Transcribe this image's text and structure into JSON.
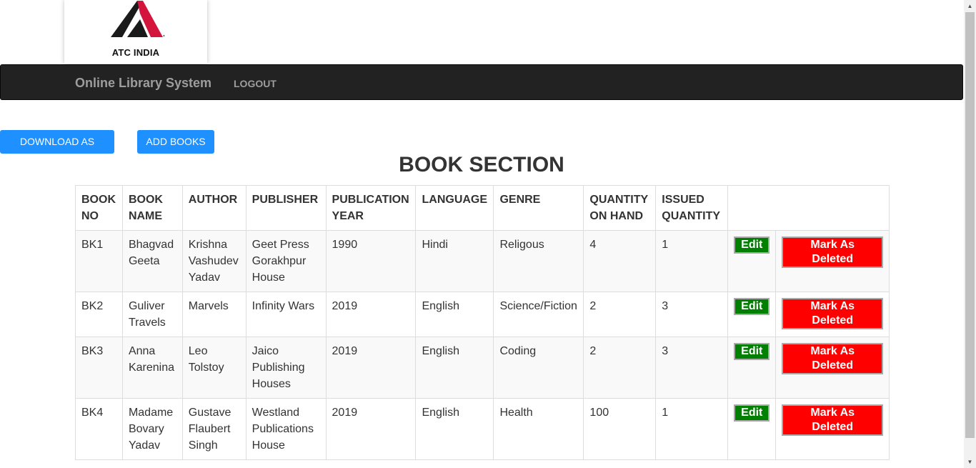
{
  "logo": {
    "text": "ATC INDIA",
    "colors": {
      "dark": "#1a1a1a",
      "red": "#d3143c"
    }
  },
  "navbar": {
    "brand": "Online Library System",
    "logout": "LOGOUT"
  },
  "actions": {
    "download_csv": "DOWNLOAD AS CSV",
    "add_books": "ADD BOOKS"
  },
  "page_title": "BOOK SECTION",
  "table": {
    "headers": {
      "book_no": "BOOK NO",
      "book_name": "BOOK NAME",
      "author": "AUTHOR",
      "publisher": "PUBLISHER",
      "publication_year": "PUBLICATION YEAR",
      "language": "LANGUAGE",
      "genre": "GENRE",
      "quantity_on_hand": "QUANTITY ON HAND",
      "issued_quantity": "ISSUED QUANTITY"
    },
    "edit_label": "Edit",
    "delete_label": "Mark As Deleted",
    "rows": [
      {
        "book_no": "BK1",
        "book_name": "Bhagvad Geeta",
        "author": "Krishna Vashudev Yadav",
        "publisher": "Geet Press Gorakhpur House",
        "year": "1990",
        "language": "Hindi",
        "genre": "Religous",
        "quantity_on_hand": "4",
        "issued": "1"
      },
      {
        "book_no": "BK2",
        "book_name": "Guliver Travels",
        "author": "Marvels",
        "publisher": "Infinity Wars",
        "year": "2019",
        "language": "English",
        "genre": "Science/Fiction",
        "quantity_on_hand": "2",
        "issued": "3"
      },
      {
        "book_no": "BK3",
        "book_name": "Anna Karenina",
        "author": "Leo Tolstoy",
        "publisher": "Jaico Publishing Houses",
        "year": "2019",
        "language": "English",
        "genre": "Coding",
        "quantity_on_hand": "2",
        "issued": "3"
      },
      {
        "book_no": "BK4",
        "book_name": "Madame Bovary Yadav",
        "author": "Gustave Flaubert Singh",
        "publisher": "Westland Publications House",
        "year": "2019",
        "language": "English",
        "genre": "Health",
        "quantity_on_hand": "100",
        "issued": "1"
      }
    ]
  },
  "colors": {
    "navbar_bg": "#222222",
    "primary_button": "#1e90ff",
    "edit_button": "#008000",
    "delete_button": "#ff0000"
  }
}
